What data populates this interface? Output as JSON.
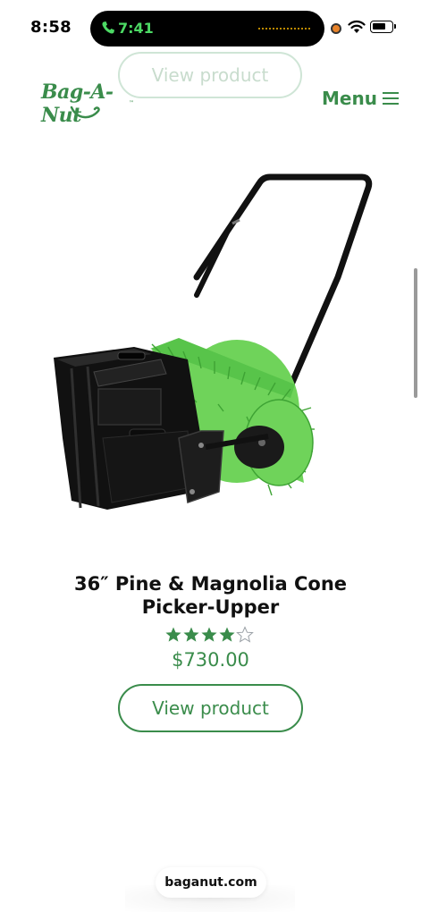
{
  "status_bar": {
    "time": "8:58",
    "call_time": "7:41",
    "call_color": "#4cd964"
  },
  "header": {
    "top_button_label": "View product",
    "logo_text": "Bag-A-Nut",
    "logo_tm": "™",
    "menu_label": "Menu",
    "brand_color": "#3a8c4b"
  },
  "product": {
    "image_icon": "lawn-roller-picker-image",
    "title": "36″ Pine & Magnolia Cone Picker-Upper",
    "rating": 4,
    "rating_max": 5,
    "price": "$730.00",
    "button_label": "View product"
  },
  "browser": {
    "url": "baganut.com"
  }
}
